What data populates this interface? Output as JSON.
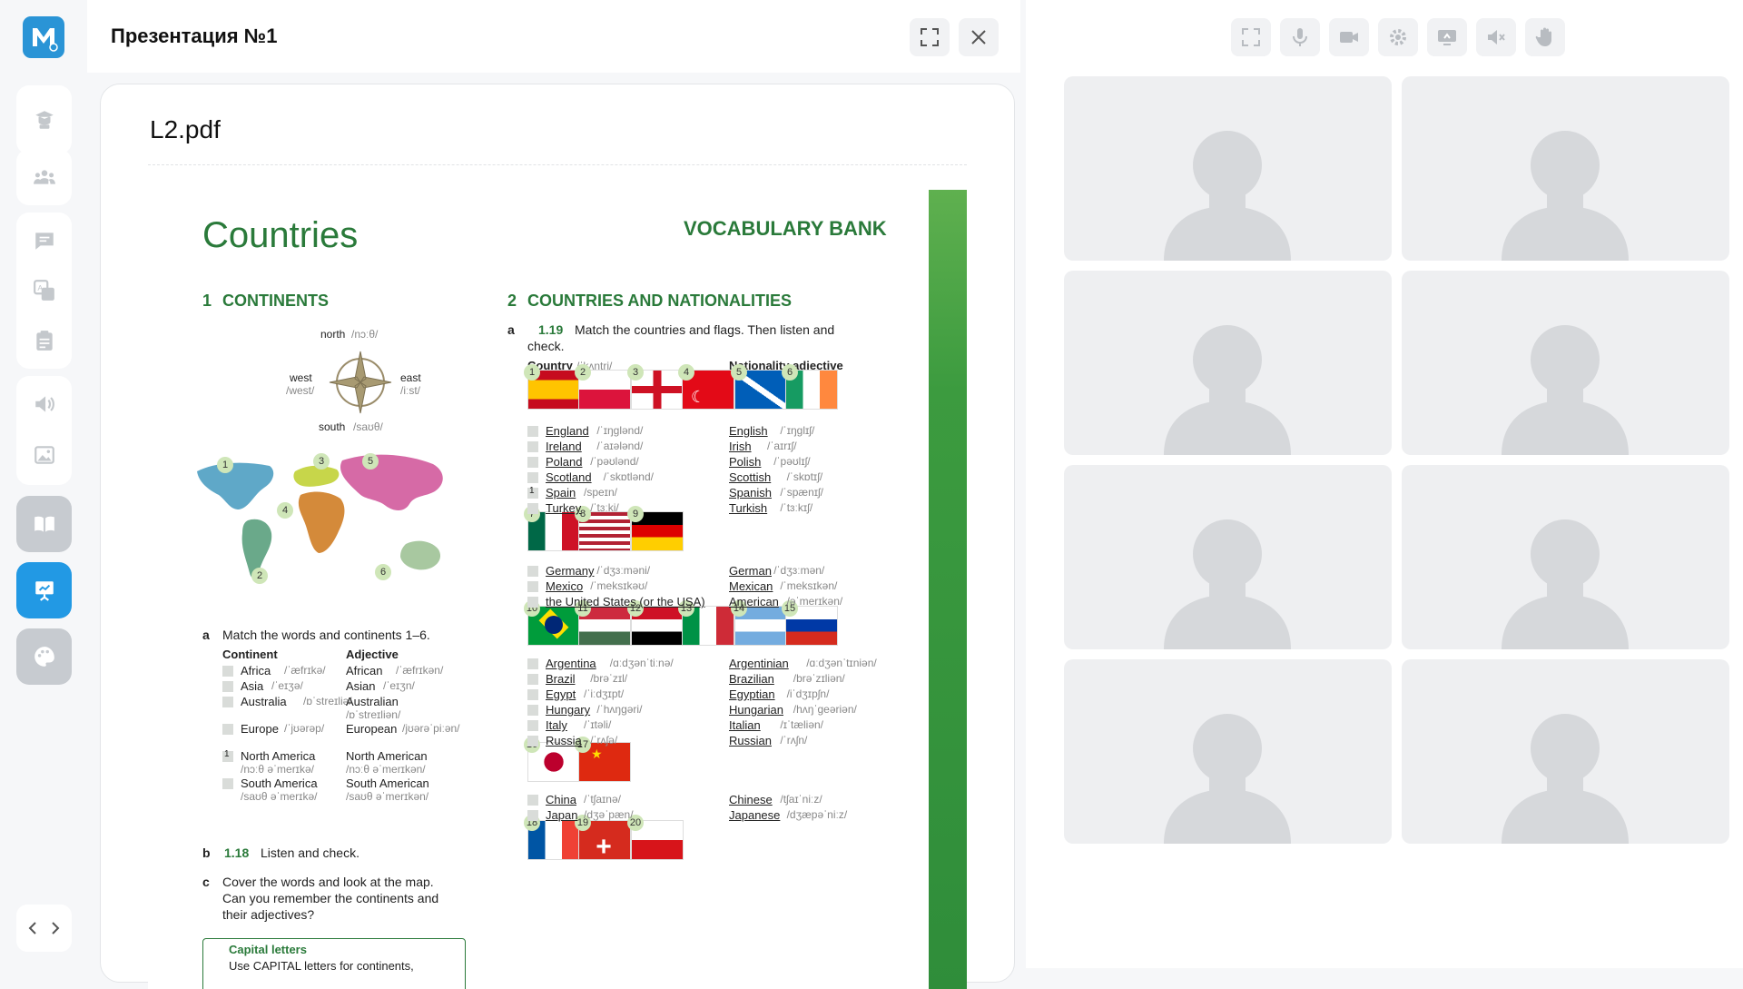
{
  "window": {
    "title": "Презентация №1"
  },
  "sidebar": {
    "logo": "M",
    "items": [
      {
        "name": "teacher-icon"
      },
      {
        "name": "users-icon"
      },
      {
        "name": "chat-icon"
      },
      {
        "name": "translate-icon"
      },
      {
        "name": "clipboard-icon"
      },
      {
        "name": "sound-icon"
      },
      {
        "name": "image-icon"
      },
      {
        "name": "book-icon"
      },
      {
        "name": "presentation-icon",
        "active": true
      },
      {
        "name": "palette-icon"
      }
    ]
  },
  "viewer": {
    "filename": "L2.pdf",
    "page": {
      "title": "Countries",
      "bank": "VOCABULARY BANK",
      "s1_num": "1",
      "s1_title": "CONTINENTS",
      "compass": {
        "north": "north",
        "north_ph": "/nɔːθ/",
        "west": "west",
        "west_ph": "/west/",
        "east": "east",
        "east_ph": "/iːst/",
        "south": "south",
        "south_ph": "/saʊθ/"
      },
      "a_label": "a",
      "a_text": "Match the words and continents 1–6.",
      "cont_head": "Continent",
      "adj_head": "Adjective",
      "continents": [
        {
          "w": "Africa",
          "p": "/ˈæfrɪkə/",
          "a": "African",
          "ap": "/ˈæfrɪkən/",
          "n": ""
        },
        {
          "w": "Asia",
          "p": "/ˈeɪʒə/",
          "a": "Asian",
          "ap": "/ˈeɪʒn/",
          "n": ""
        },
        {
          "w": "Australia",
          "p": "/ɒˈstreɪliə/",
          "a": "Australian",
          "ap": "/ɒˈstreɪliən/",
          "n": ""
        },
        {
          "w": "Europe",
          "p": "/ˈjʊərəp/",
          "a": "European",
          "ap": "/jʊərəˈpiːən/",
          "n": ""
        },
        {
          "w": "North America",
          "p": "/nɔːθ əˈmerɪkə/",
          "a": "North American",
          "ap": "/nɔːθ əˈmerɪkən/",
          "n": "1"
        },
        {
          "w": "South America",
          "p": "/saʊθ əˈmerɪkə/",
          "a": "South American",
          "ap": "/saʊθ əˈmerɪkən/",
          "n": ""
        }
      ],
      "b_label": "b",
      "b_track": "1.18",
      "b_text": "Listen and check.",
      "c_label": "c",
      "c_text1": "Cover the words and look at the map.",
      "c_text2": "Can you remember the continents and",
      "c_text3": "their adjectives?",
      "tip_title": "Capital letters",
      "tip_text": "Use CAPITAL letters for continents,",
      "s2_num": "2",
      "s2_title": "COUNTRIES AND NATIONALITIES",
      "s2a_label": "a",
      "s2a_track": "1.19",
      "s2a_text1": "Match the countries and flags. Then listen and",
      "s2a_text2": "check.",
      "country_head": "Country",
      "country_ph": "/ˈkʌntri/",
      "nat_head": "Nationality adjective",
      "group1": [
        {
          "c": "England",
          "cp": "/ˈɪŋɡlənd/",
          "n": "English",
          "np": "/ˈɪŋɡlɪʃ/",
          "k": ""
        },
        {
          "c": "Ireland",
          "cp": "/ˈaɪələnd/",
          "n": "Irish",
          "np": "/ˈaɪrɪʃ/",
          "k": ""
        },
        {
          "c": "Poland",
          "cp": "/ˈpəʊlənd/",
          "n": "Polish",
          "np": "/ˈpəʊlɪʃ/",
          "k": ""
        },
        {
          "c": "Scotland",
          "cp": "/ˈskɒtlənd/",
          "n": "Scottish",
          "np": "/ˈskɒtɪʃ/",
          "k": ""
        },
        {
          "c": "Spain",
          "cp": "/speɪn/",
          "n": "Spanish",
          "np": "/ˈspænɪʃ/",
          "k": "1"
        },
        {
          "c": "Turkey",
          "cp": "/ˈtɜːki/",
          "n": "Turkish",
          "np": "/ˈtɜːkɪʃ/",
          "k": ""
        }
      ],
      "group2": [
        {
          "c": "Germany",
          "cp": "/ˈdʒɜːməni/",
          "n": "German",
          "np": "/ˈdʒɜːmən/"
        },
        {
          "c": "Mexico",
          "cp": "/ˈmeksɪkəʊ/",
          "n": "Mexican",
          "np": "/ˈmeksɪkən/"
        },
        {
          "c": "the United States (or the USA)",
          "cp": "",
          "n": "American",
          "np": "/əˈmerɪkən/"
        }
      ],
      "group3": [
        {
          "c": "Argentina",
          "cp": "/ɑːdʒənˈtiːnə/",
          "n": "Argentinian",
          "np": "/ɑːdʒənˈtɪniən/"
        },
        {
          "c": "Brazil",
          "cp": "/brəˈzɪl/",
          "n": "Brazilian",
          "np": "/brəˈzɪliən/"
        },
        {
          "c": "Egypt",
          "cp": "/ˈiːdʒɪpt/",
          "n": "Egyptian",
          "np": "/iˈdʒɪpʃn/"
        },
        {
          "c": "Hungary",
          "cp": "/ˈhʌŋɡəri/",
          "n": "Hungarian",
          "np": "/hʌŋˈɡeəriən/"
        },
        {
          "c": "Italy",
          "cp": "/ˈɪtəli/",
          "n": "Italian",
          "np": "/ɪˈtæliən/"
        },
        {
          "c": "Russia",
          "cp": "/ˈrʌʃə/",
          "n": "Russian",
          "np": "/ˈrʌʃn/"
        }
      ],
      "group4": [
        {
          "c": "China",
          "cp": "/ˈtʃaɪnə/",
          "n": "Chinese",
          "np": "/tʃaɪˈniːz/"
        },
        {
          "c": "Japan",
          "cp": "/dʒəˈpæn/",
          "n": "Japanese",
          "np": "/dʒæpəˈniːz/"
        }
      ],
      "flags_row1": [
        "1",
        "2",
        "3",
        "4",
        "5",
        "6"
      ],
      "flags_row2": [
        "7",
        "8",
        "9"
      ],
      "flags_row3": [
        "10",
        "11",
        "12",
        "13",
        "14",
        "15"
      ],
      "flags_row4": [
        "16",
        "17"
      ],
      "flags_row5": [
        "18",
        "19",
        "20"
      ],
      "map_nums": [
        "1",
        "2",
        "3",
        "4",
        "5",
        "6"
      ]
    }
  },
  "video": {
    "tiles": 8
  },
  "colors": {
    "accent": "#2299e4",
    "green": "#2a7a3a"
  }
}
